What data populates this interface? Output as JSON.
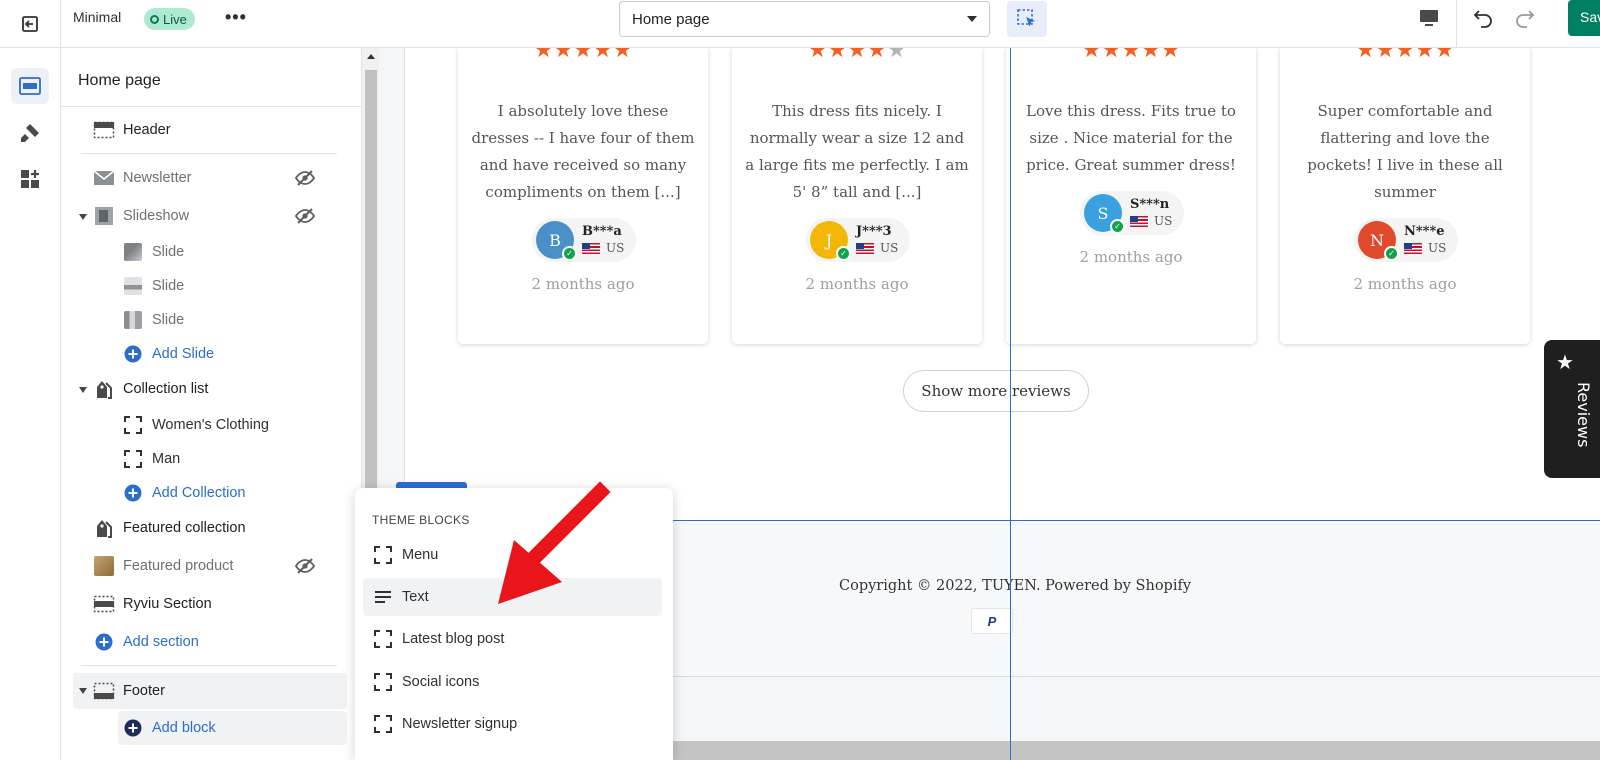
{
  "topbar": {
    "theme_name": "Minimal",
    "status": "Live",
    "more": "•••",
    "page_select": "Home page",
    "save_label": "Save"
  },
  "sidebar": {
    "title": "Home page",
    "sections": {
      "header": "Header",
      "newsletter": "Newsletter",
      "slideshow": "Slideshow",
      "slides": [
        "Slide",
        "Slide",
        "Slide"
      ],
      "add_slide": "Add Slide",
      "collection_list": "Collection list",
      "collections": [
        "Women's Clothing",
        "Man"
      ],
      "add_collection": "Add Collection",
      "featured_collection": "Featured collection",
      "featured_product": "Featured product",
      "ryviu_section": "Ryviu Section",
      "add_section": "Add section",
      "footer": "Footer",
      "add_block": "Add block"
    }
  },
  "popover": {
    "title": "THEME BLOCKS",
    "items": [
      "Menu",
      "Text",
      "Latest blog post",
      "Social icons",
      "Newsletter signup"
    ]
  },
  "reviews": [
    {
      "rating": 5,
      "text": "I absolutely love these dresses -- I have four of them and have received so many compliments on them [...]",
      "initial": "B",
      "name": "B***a",
      "country": "US",
      "date": "2 months ago",
      "avatar_color": "#4a8fc8"
    },
    {
      "rating": 4,
      "text": "This dress fits nicely. I normally wear a size 12 and a large fits me perfectly. I am 5' 8” tall and [...]",
      "initial": "J",
      "name": "J***3",
      "country": "US",
      "date": "2 months ago",
      "avatar_color": "#f2b705"
    },
    {
      "rating": 5,
      "text": "Love this dress. Fits true to size . Nice material for the price. Great summer dress!",
      "initial": "S",
      "name": "S***n",
      "country": "US",
      "date": "2 months ago",
      "avatar_color": "#3aa1e0"
    },
    {
      "rating": 5,
      "text": "Super comfortable and flattering and love the pockets! I live in these all summer",
      "initial": "N",
      "name": "N***e",
      "country": "US",
      "date": "2 months ago",
      "avatar_color": "#e0492c"
    }
  ],
  "preview": {
    "show_more": "Show more reviews",
    "copyright": "Copyright © 2022, TUYEN. Powered by Shopify",
    "payment": "P",
    "reviews_tab": "Reviews"
  },
  "colors": {
    "accent": "#2c6ecb",
    "star": "#f26122",
    "save": "#008060",
    "live_badge": "#aee9d1",
    "annotation_arrow": "#e8161b"
  }
}
